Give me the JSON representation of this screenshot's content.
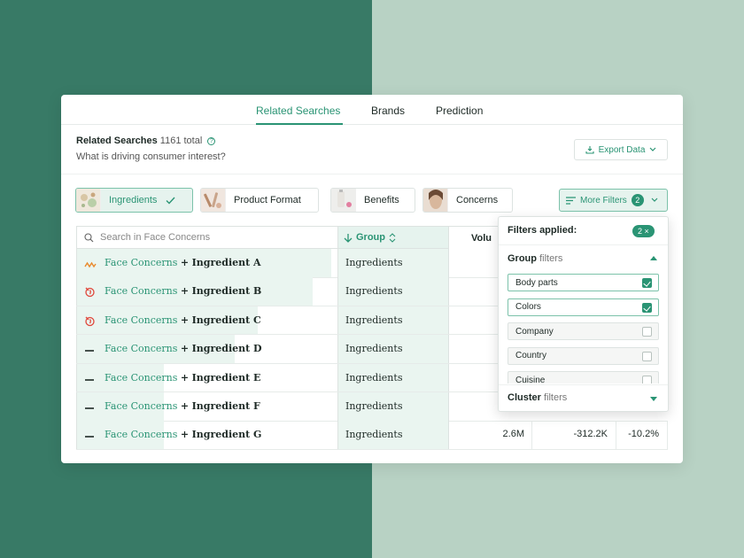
{
  "tabs": [
    {
      "label": "Related Searches",
      "active": true
    },
    {
      "label": "Brands",
      "active": false
    },
    {
      "label": "Prediction",
      "active": false
    }
  ],
  "header": {
    "title": "Related Searches",
    "count": "1161 total",
    "subtitle": "What is driving consumer interest?",
    "export_label": "Export Data"
  },
  "chips": [
    {
      "label": "Ingredients",
      "active": true,
      "thumb": "ingredients-thumbnail"
    },
    {
      "label": "Product Format",
      "active": false,
      "thumb": "product-format-thumbnail"
    },
    {
      "label": "Benefits",
      "active": false,
      "thumb": "benefits-thumbnail"
    },
    {
      "label": "Concerns",
      "active": false,
      "thumb": "concerns-thumbnail"
    }
  ],
  "more_filters": {
    "label": "More Filters",
    "count": "2"
  },
  "table": {
    "search_placeholder": "Search in Face Concerns",
    "group_header": "Group",
    "volume_header": "Volu",
    "rows": [
      {
        "prefix": "Face Concerns",
        "plus": "+",
        "name": "Ingredient A",
        "group": "Ingredients",
        "trend_icon": "trending-wave-icon",
        "share": 0.97
      },
      {
        "prefix": "Face Concerns",
        "plus": "+",
        "name": "Ingredient B",
        "group": "Ingredients",
        "trend_icon": "fire-icon",
        "share": 0.9
      },
      {
        "prefix": "Face Concerns",
        "plus": "+",
        "name": "Ingredient C",
        "group": "Ingredients",
        "trend_icon": "fire-icon",
        "share": 0.69
      },
      {
        "prefix": "Face Concerns",
        "plus": "+",
        "name": "Ingredient D",
        "group": "Ingredients",
        "trend_icon": "dash-icon",
        "share": 0.6
      },
      {
        "prefix": "Face Concerns",
        "plus": "+",
        "name": "Ingredient E",
        "group": "Ingredients",
        "trend_icon": "dash-icon",
        "share": 0.33
      },
      {
        "prefix": "Face Concerns",
        "plus": "+",
        "name": "Ingredient F",
        "group": "Ingredients",
        "trend_icon": "dash-icon",
        "share": 0.33
      },
      {
        "prefix": "Face Concerns",
        "plus": "+",
        "name": "Ingredient G",
        "group": "Ingredients",
        "trend_icon": "dash-icon",
        "share": 0.33,
        "volume": "2.6M",
        "change_abs": "-312.2K",
        "change_pct": "-10.2%"
      }
    ]
  },
  "dropdown": {
    "title": "Filters applied:",
    "badge": "2 ×",
    "group_bold": "Group",
    "group_rest": "filters",
    "options": [
      {
        "label": "Body parts",
        "checked": true
      },
      {
        "label": "Colors",
        "checked": true
      },
      {
        "label": "Company",
        "checked": false
      },
      {
        "label": "Country",
        "checked": false
      },
      {
        "label": "Cuisine",
        "checked": false
      }
    ],
    "cluster_bold": "Cluster",
    "cluster_rest": "filters"
  },
  "colors": {
    "accent": "#2a9474",
    "accent_light": "#e6f3ee",
    "trend_wave": "#e98a2d",
    "fire": "#e0463a"
  }
}
